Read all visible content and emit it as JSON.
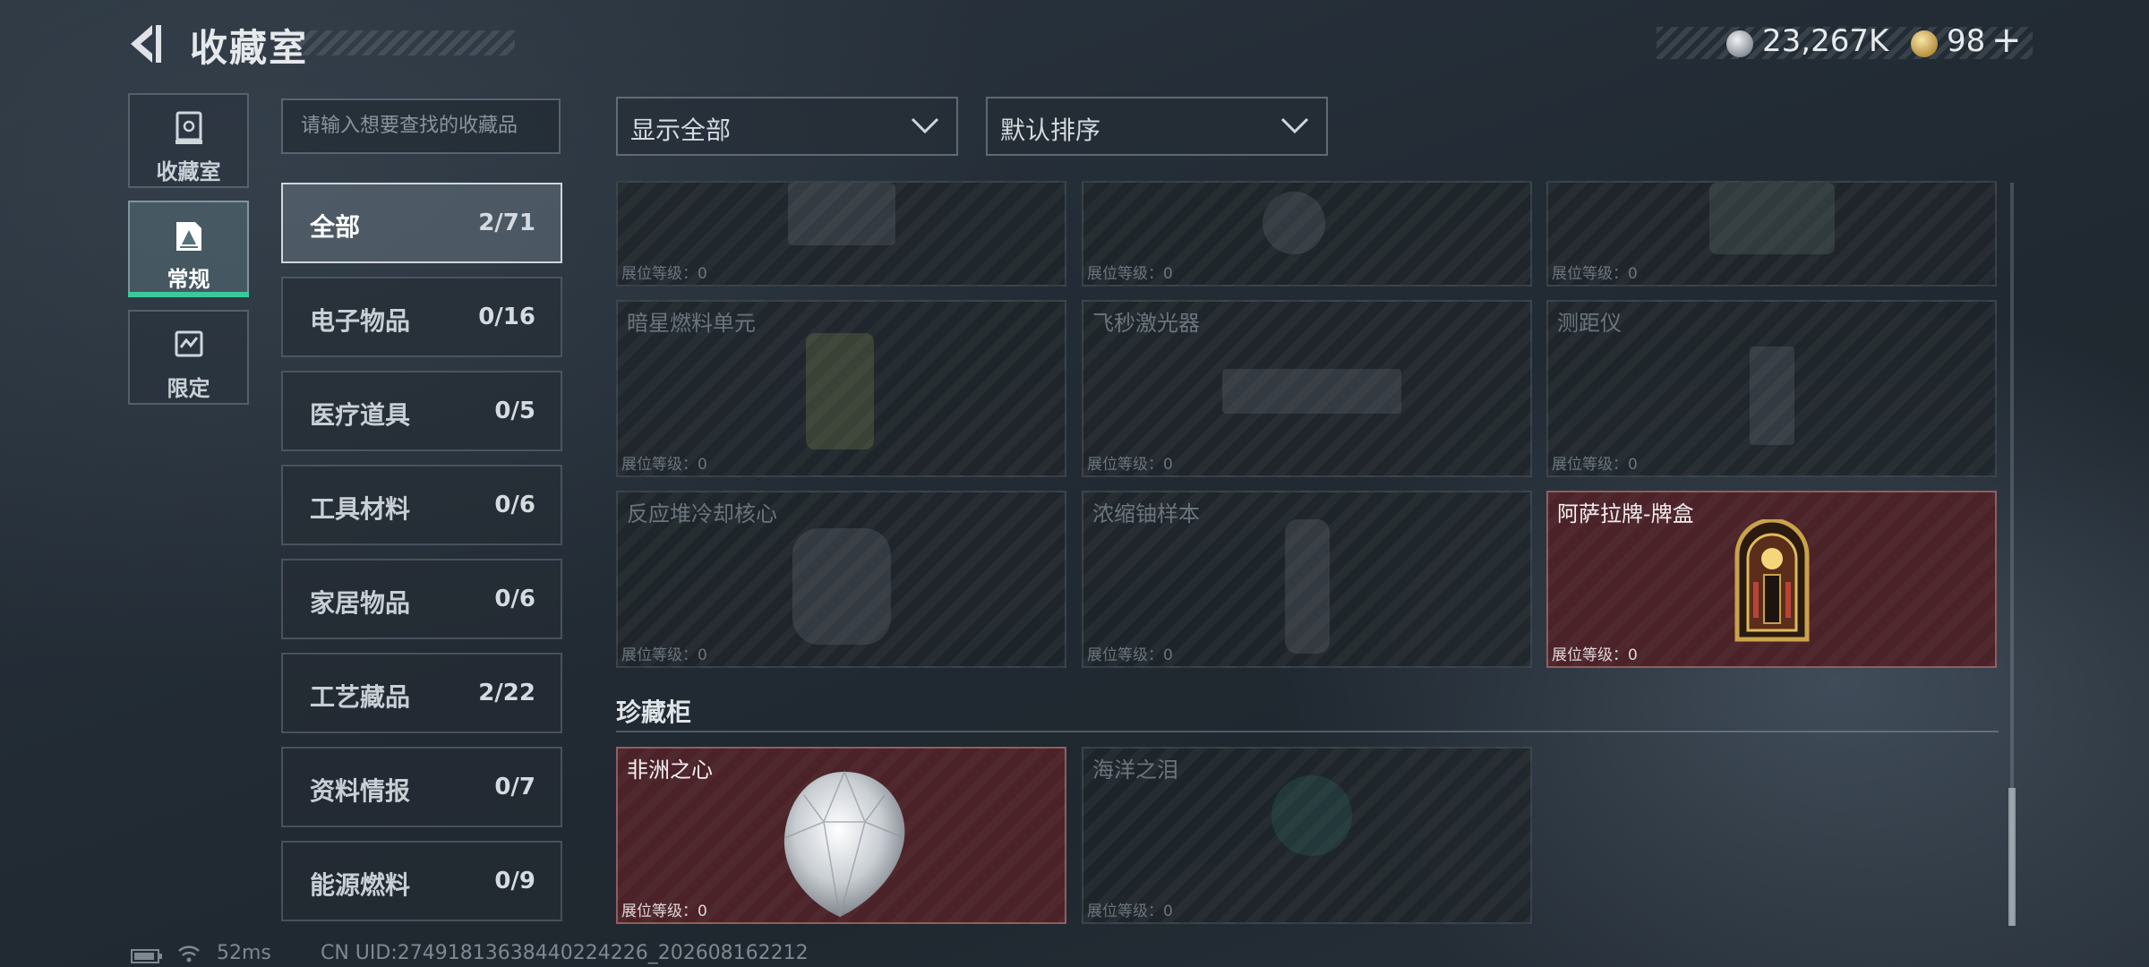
{
  "header": {
    "title": "收藏室",
    "currency_silver": "23,267K",
    "currency_gold": "98",
    "plus": "+"
  },
  "side_tabs": [
    {
      "label": "收藏室"
    },
    {
      "label": "常规",
      "active": true
    },
    {
      "label": "限定"
    }
  ],
  "search": {
    "placeholder": "请输入想要查找的收藏品"
  },
  "categories": [
    {
      "name": "全部",
      "count": "2/71",
      "active": true
    },
    {
      "name": "电子物品",
      "count": "0/16"
    },
    {
      "name": "医疗道具",
      "count": "0/5"
    },
    {
      "name": "工具材料",
      "count": "0/6"
    },
    {
      "name": "家居物品",
      "count": "0/6"
    },
    {
      "name": "工艺藏品",
      "count": "2/22"
    },
    {
      "name": "资料情报",
      "count": "0/7"
    },
    {
      "name": "能源燃料",
      "count": "0/9"
    }
  ],
  "filters": {
    "show": "显示全部",
    "sort": "默认排序"
  },
  "level_label": "展位等级：0",
  "items": [
    {
      "name": "",
      "owned": false
    },
    {
      "name": "",
      "owned": false
    },
    {
      "name": "",
      "owned": false
    },
    {
      "name": "暗星燃料单元",
      "owned": false
    },
    {
      "name": "飞秒激光器",
      "owned": false
    },
    {
      "name": "测距仪",
      "owned": false
    },
    {
      "name": "反应堆冷却核心",
      "owned": false
    },
    {
      "name": "浓缩铀样本",
      "owned": false
    },
    {
      "name": "阿萨拉牌-牌盒",
      "owned": true
    }
  ],
  "treasure_section": {
    "title": "珍藏柜",
    "items": [
      {
        "name": "非洲之心",
        "owned": true
      },
      {
        "name": "海洋之泪",
        "owned": false
      }
    ]
  },
  "footer": {
    "ping": "52ms",
    "uid": "CN UID:27491813638440224226_202608162212"
  },
  "colors": {
    "accent": "#3cc89a",
    "owned_card": "#4a2227"
  }
}
